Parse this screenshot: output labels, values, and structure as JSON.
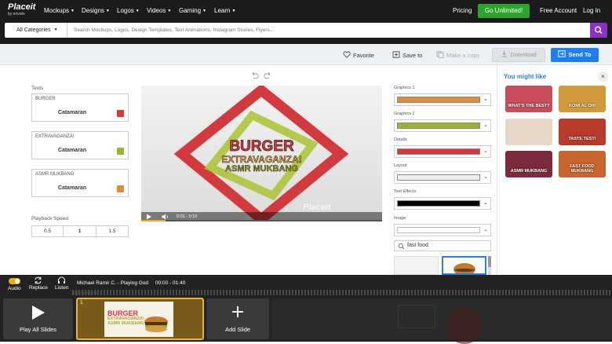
{
  "brand": {
    "name": "Placeit",
    "sub": "by envato"
  },
  "nav": {
    "items": [
      "Mockups",
      "Designs",
      "Logos",
      "Videos",
      "Gaming",
      "Learn"
    ],
    "pricing": "Pricing",
    "cta": "Go Unlimited!",
    "free_account": "Free Account",
    "login": "Log In"
  },
  "search": {
    "category": "All Categories",
    "placeholder": "Search Mockups, Logos, Design Templates, Text Animations, Instagram Stories, Flyers..."
  },
  "actions": {
    "favorite": "Favorite",
    "save": "Save to",
    "copy": "Make a copy",
    "download": "Download",
    "send": "Send To"
  },
  "editor": {
    "texts_label": "Texts",
    "texts": [
      {
        "value": "BURGER",
        "font": "Catamaran",
        "color": "#d23a3e"
      },
      {
        "value": "EXTRAVAGANZA!",
        "font": "Catamaran",
        "color": "#9db32a"
      },
      {
        "value": "ASMR MUKBANG",
        "font": "Catamaran",
        "color": "#dd8e3a"
      }
    ],
    "speed_label": "Playback Speed",
    "speeds": [
      "0.5",
      "1",
      "1.5"
    ],
    "speed_selected": "1"
  },
  "video": {
    "time": "0:01 - 0:10",
    "watermark": "Placeit",
    "title_lines": [
      "BURGER",
      "EXTRAVAGANZA!",
      "ASMR MUKBANG"
    ],
    "progress": 0.1
  },
  "properties": {
    "graphics1": {
      "label": "Graphics 1",
      "color": "#dd8e3a"
    },
    "graphics2": {
      "label": "Graphics 2",
      "color": "#9db32a"
    },
    "details": {
      "label": "Details",
      "color": "#d23a3e"
    },
    "layout": {
      "label": "Layout",
      "color": "#eeeeee"
    },
    "text_effects": {
      "label": "Text Effects",
      "color": "#000000"
    },
    "image": {
      "label": "Image"
    },
    "image_search": "fast food"
  },
  "suggestions": {
    "title": "You might like",
    "items": [
      {
        "label": "WHAT'S THE BEST?",
        "bg": "#c94d5c"
      },
      {
        "label": "KOMI AL DHI",
        "bg": "#d39a3c"
      },
      {
        "label": "",
        "bg": "#e7d7c8"
      },
      {
        "label": "TASTE TEST!",
        "bg": "#b83a28"
      },
      {
        "label": "ASMR MUKBANG",
        "bg": "#7d2b3c"
      },
      {
        "label": "FAST FOOD MUKBANG",
        "bg": "#c9652c"
      }
    ]
  },
  "bottom": {
    "audio": "Audio",
    "replace": "Replace",
    "listen": "Listen",
    "track": "Michael Ramir C. - Playing God",
    "duration": "00:00 - 01:40",
    "play_all": "Play All Slides",
    "slide_number": "1",
    "slide_lines": [
      "BURGER",
      "EXTRAVAGANZA!",
      "ASMR MUKBANG"
    ],
    "add_slide": "Add Slide"
  }
}
